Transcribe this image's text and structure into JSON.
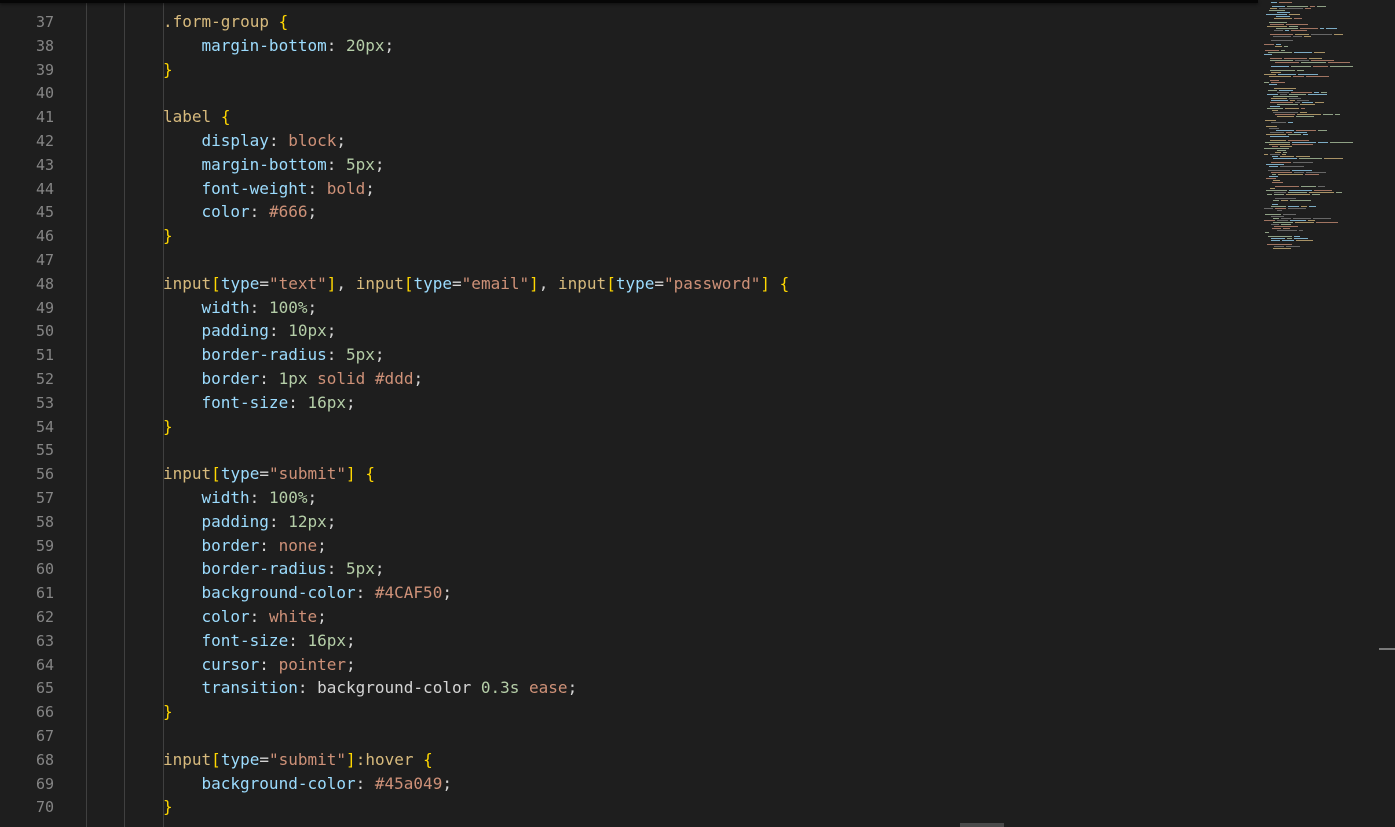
{
  "editor": {
    "language": "css",
    "lines": [
      {
        "number": "37",
        "indent": 2,
        "tokens": [
          {
            "t": ".form-group",
            "c": "selector"
          },
          {
            "t": " ",
            "c": "plain"
          },
          {
            "t": "{",
            "c": "brace"
          }
        ]
      },
      {
        "number": "38",
        "indent": 3,
        "tokens": [
          {
            "t": "margin-bottom",
            "c": "prop"
          },
          {
            "t": ": ",
            "c": "punct"
          },
          {
            "t": "20px",
            "c": "num"
          },
          {
            "t": ";",
            "c": "punct"
          }
        ]
      },
      {
        "number": "39",
        "indent": 2,
        "tokens": [
          {
            "t": "}",
            "c": "brace"
          }
        ]
      },
      {
        "number": "40",
        "indent": 0,
        "tokens": []
      },
      {
        "number": "41",
        "indent": 2,
        "tokens": [
          {
            "t": "label",
            "c": "tag"
          },
          {
            "t": " ",
            "c": "plain"
          },
          {
            "t": "{",
            "c": "brace"
          }
        ]
      },
      {
        "number": "42",
        "indent": 3,
        "tokens": [
          {
            "t": "display",
            "c": "prop"
          },
          {
            "t": ": ",
            "c": "punct"
          },
          {
            "t": "block",
            "c": "value"
          },
          {
            "t": ";",
            "c": "punct"
          }
        ]
      },
      {
        "number": "43",
        "indent": 3,
        "tokens": [
          {
            "t": "margin-bottom",
            "c": "prop"
          },
          {
            "t": ": ",
            "c": "punct"
          },
          {
            "t": "5px",
            "c": "num"
          },
          {
            "t": ";",
            "c": "punct"
          }
        ]
      },
      {
        "number": "44",
        "indent": 3,
        "tokens": [
          {
            "t": "font-weight",
            "c": "prop"
          },
          {
            "t": ": ",
            "c": "punct"
          },
          {
            "t": "bold",
            "c": "value"
          },
          {
            "t": ";",
            "c": "punct"
          }
        ]
      },
      {
        "number": "45",
        "indent": 3,
        "tokens": [
          {
            "t": "color",
            "c": "prop"
          },
          {
            "t": ": ",
            "c": "punct"
          },
          {
            "t": "#666",
            "c": "value"
          },
          {
            "t": ";",
            "c": "punct"
          }
        ]
      },
      {
        "number": "46",
        "indent": 2,
        "tokens": [
          {
            "t": "}",
            "c": "brace"
          }
        ]
      },
      {
        "number": "47",
        "indent": 0,
        "tokens": []
      },
      {
        "number": "48",
        "indent": 2,
        "tokens": [
          {
            "t": "input",
            "c": "tag"
          },
          {
            "t": "[",
            "c": "bracket"
          },
          {
            "t": "type",
            "c": "attr"
          },
          {
            "t": "=",
            "c": "punct"
          },
          {
            "t": "\"text\"",
            "c": "string"
          },
          {
            "t": "]",
            "c": "bracket"
          },
          {
            "t": ", ",
            "c": "punct"
          },
          {
            "t": "input",
            "c": "tag"
          },
          {
            "t": "[",
            "c": "bracket"
          },
          {
            "t": "type",
            "c": "attr"
          },
          {
            "t": "=",
            "c": "punct"
          },
          {
            "t": "\"email\"",
            "c": "string"
          },
          {
            "t": "]",
            "c": "bracket"
          },
          {
            "t": ", ",
            "c": "punct"
          },
          {
            "t": "input",
            "c": "tag"
          },
          {
            "t": "[",
            "c": "bracket"
          },
          {
            "t": "type",
            "c": "attr"
          },
          {
            "t": "=",
            "c": "punct"
          },
          {
            "t": "\"password\"",
            "c": "string"
          },
          {
            "t": "]",
            "c": "bracket"
          },
          {
            "t": " ",
            "c": "plain"
          },
          {
            "t": "{",
            "c": "brace"
          }
        ]
      },
      {
        "number": "49",
        "indent": 3,
        "tokens": [
          {
            "t": "width",
            "c": "prop"
          },
          {
            "t": ": ",
            "c": "punct"
          },
          {
            "t": "100%",
            "c": "num"
          },
          {
            "t": ";",
            "c": "punct"
          }
        ]
      },
      {
        "number": "50",
        "indent": 3,
        "tokens": [
          {
            "t": "padding",
            "c": "prop"
          },
          {
            "t": ": ",
            "c": "punct"
          },
          {
            "t": "10px",
            "c": "num"
          },
          {
            "t": ";",
            "c": "punct"
          }
        ]
      },
      {
        "number": "51",
        "indent": 3,
        "tokens": [
          {
            "t": "border-radius",
            "c": "prop"
          },
          {
            "t": ": ",
            "c": "punct"
          },
          {
            "t": "5px",
            "c": "num"
          },
          {
            "t": ";",
            "c": "punct"
          }
        ]
      },
      {
        "number": "52",
        "indent": 3,
        "tokens": [
          {
            "t": "border",
            "c": "prop"
          },
          {
            "t": ": ",
            "c": "punct"
          },
          {
            "t": "1px",
            "c": "num"
          },
          {
            "t": " ",
            "c": "plain"
          },
          {
            "t": "solid",
            "c": "value"
          },
          {
            "t": " ",
            "c": "plain"
          },
          {
            "t": "#ddd",
            "c": "value"
          },
          {
            "t": ";",
            "c": "punct"
          }
        ]
      },
      {
        "number": "53",
        "indent": 3,
        "tokens": [
          {
            "t": "font-size",
            "c": "prop"
          },
          {
            "t": ": ",
            "c": "punct"
          },
          {
            "t": "16px",
            "c": "num"
          },
          {
            "t": ";",
            "c": "punct"
          }
        ]
      },
      {
        "number": "54",
        "indent": 2,
        "tokens": [
          {
            "t": "}",
            "c": "brace"
          }
        ]
      },
      {
        "number": "55",
        "indent": 0,
        "tokens": []
      },
      {
        "number": "56",
        "indent": 2,
        "tokens": [
          {
            "t": "input",
            "c": "tag"
          },
          {
            "t": "[",
            "c": "bracket"
          },
          {
            "t": "type",
            "c": "attr"
          },
          {
            "t": "=",
            "c": "punct"
          },
          {
            "t": "\"submit\"",
            "c": "string"
          },
          {
            "t": "]",
            "c": "bracket"
          },
          {
            "t": " ",
            "c": "plain"
          },
          {
            "t": "{",
            "c": "brace"
          }
        ]
      },
      {
        "number": "57",
        "indent": 3,
        "tokens": [
          {
            "t": "width",
            "c": "prop"
          },
          {
            "t": ": ",
            "c": "punct"
          },
          {
            "t": "100%",
            "c": "num"
          },
          {
            "t": ";",
            "c": "punct"
          }
        ]
      },
      {
        "number": "58",
        "indent": 3,
        "tokens": [
          {
            "t": "padding",
            "c": "prop"
          },
          {
            "t": ": ",
            "c": "punct"
          },
          {
            "t": "12px",
            "c": "num"
          },
          {
            "t": ";",
            "c": "punct"
          }
        ]
      },
      {
        "number": "59",
        "indent": 3,
        "tokens": [
          {
            "t": "border",
            "c": "prop"
          },
          {
            "t": ": ",
            "c": "punct"
          },
          {
            "t": "none",
            "c": "value"
          },
          {
            "t": ";",
            "c": "punct"
          }
        ]
      },
      {
        "number": "60",
        "indent": 3,
        "tokens": [
          {
            "t": "border-radius",
            "c": "prop"
          },
          {
            "t": ": ",
            "c": "punct"
          },
          {
            "t": "5px",
            "c": "num"
          },
          {
            "t": ";",
            "c": "punct"
          }
        ]
      },
      {
        "number": "61",
        "indent": 3,
        "tokens": [
          {
            "t": "background-color",
            "c": "prop"
          },
          {
            "t": ": ",
            "c": "punct"
          },
          {
            "t": "#4CAF50",
            "c": "value"
          },
          {
            "t": ";",
            "c": "punct"
          }
        ]
      },
      {
        "number": "62",
        "indent": 3,
        "tokens": [
          {
            "t": "color",
            "c": "prop"
          },
          {
            "t": ": ",
            "c": "punct"
          },
          {
            "t": "white",
            "c": "value"
          },
          {
            "t": ";",
            "c": "punct"
          }
        ]
      },
      {
        "number": "63",
        "indent": 3,
        "tokens": [
          {
            "t": "font-size",
            "c": "prop"
          },
          {
            "t": ": ",
            "c": "punct"
          },
          {
            "t": "16px",
            "c": "num"
          },
          {
            "t": ";",
            "c": "punct"
          }
        ]
      },
      {
        "number": "64",
        "indent": 3,
        "tokens": [
          {
            "t": "cursor",
            "c": "prop"
          },
          {
            "t": ": ",
            "c": "punct"
          },
          {
            "t": "pointer",
            "c": "value"
          },
          {
            "t": ";",
            "c": "punct"
          }
        ]
      },
      {
        "number": "65",
        "indent": 3,
        "tokens": [
          {
            "t": "transition",
            "c": "prop"
          },
          {
            "t": ": ",
            "c": "punct"
          },
          {
            "t": "background-color",
            "c": "plain"
          },
          {
            "t": " ",
            "c": "plain"
          },
          {
            "t": "0.3s",
            "c": "num"
          },
          {
            "t": " ",
            "c": "plain"
          },
          {
            "t": "ease",
            "c": "value"
          },
          {
            "t": ";",
            "c": "punct"
          }
        ]
      },
      {
        "number": "66",
        "indent": 2,
        "tokens": [
          {
            "t": "}",
            "c": "brace"
          }
        ]
      },
      {
        "number": "67",
        "indent": 0,
        "tokens": []
      },
      {
        "number": "68",
        "indent": 2,
        "tokens": [
          {
            "t": "input",
            "c": "tag"
          },
          {
            "t": "[",
            "c": "bracket"
          },
          {
            "t": "type",
            "c": "attr"
          },
          {
            "t": "=",
            "c": "punct"
          },
          {
            "t": "\"submit\"",
            "c": "string"
          },
          {
            "t": "]",
            "c": "bracket"
          },
          {
            "t": ":hover",
            "c": "selector"
          },
          {
            "t": " ",
            "c": "plain"
          },
          {
            "t": "{",
            "c": "brace"
          }
        ]
      },
      {
        "number": "69",
        "indent": 3,
        "tokens": [
          {
            "t": "background-color",
            "c": "prop"
          },
          {
            "t": ": ",
            "c": "punct"
          },
          {
            "t": "#45a049",
            "c": "value"
          },
          {
            "t": ";",
            "c": "punct"
          }
        ]
      },
      {
        "number": "70",
        "indent": 2,
        "tokens": [
          {
            "t": "}",
            "c": "brace"
          }
        ]
      }
    ]
  },
  "colors": {
    "background": "#1e1e1e",
    "line_number": "#858585",
    "selector": "#d7ba7d",
    "brace": "#ffd700",
    "property": "#9cdcfe",
    "string": "#ce9178",
    "number": "#b5cea8",
    "value": "#ce9178",
    "punctuation": "#d4d4d4",
    "indent_guide": "#404040"
  }
}
